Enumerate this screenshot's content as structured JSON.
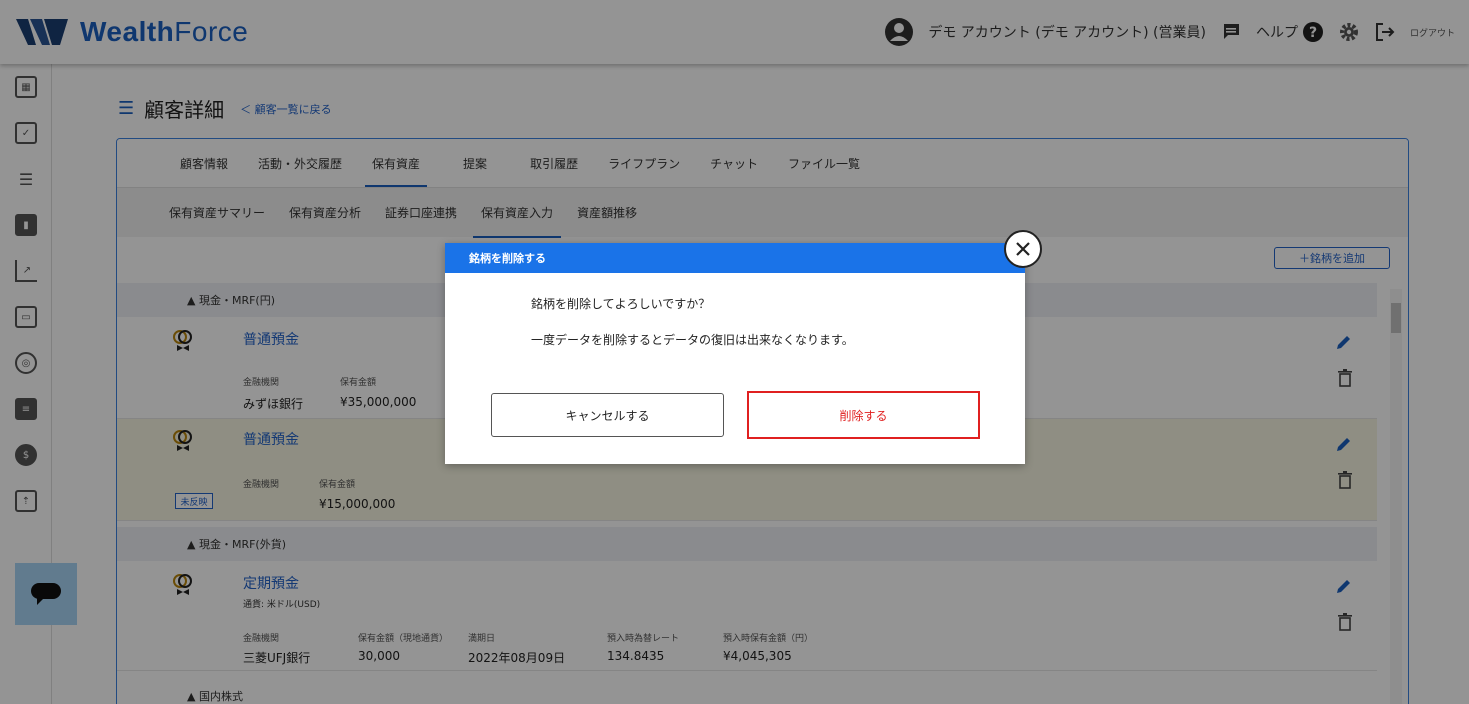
{
  "header": {
    "logo_text_bold": "Wealth",
    "logo_text_light": "Force",
    "user_name": "デモ アカウント (デモ アカウント) (営業員)",
    "help_label": "ヘルプ",
    "logout_label": "ログアウト"
  },
  "page": {
    "title": "顧客詳細",
    "back_link": "＜ 顧客一覧に戻る"
  },
  "tabs": [
    "顧客情報",
    "活動・外交履歴",
    "保有資産",
    "提案",
    "取引履歴",
    "ライフプラン",
    "チャット",
    "ファイル一覧"
  ],
  "subtabs": [
    "保有資産サマリー",
    "保有資産分析",
    "証券口座連携",
    "保有資産入力",
    "資産額推移"
  ],
  "add_button": "＋銘柄を追加",
  "sections": {
    "cash_jpy": "▲ 現金・MRF(円)",
    "cash_fx": "▲ 現金・MRF(外貨)",
    "domestic_stock": "▲ 国内株式"
  },
  "rows": {
    "r1": {
      "name": "普通預金",
      "lbl_inst": "金融機関",
      "lbl_amount": "保有金額",
      "inst": "みずほ銀行",
      "amount": "¥35,000,000"
    },
    "r2": {
      "name": "普通預金",
      "lbl_inst": "金融機関",
      "lbl_amount": "保有金額",
      "amount": "¥15,000,000",
      "badge": "未反映"
    },
    "r3": {
      "name": "定期預金",
      "currency": "通貨: 米ドル(USD)",
      "lbl_inst": "金融機関",
      "lbl_amount": "保有金額（現地通貨）",
      "lbl_maturity": "満期日",
      "lbl_rate": "預入時為替レート",
      "lbl_jpy": "預入時保有金額（円）",
      "inst": "三菱UFJ銀行",
      "amount": "30,000",
      "maturity": "2022年08月09日",
      "rate": "134.8435",
      "jpy": "¥4,045,305"
    }
  },
  "modal": {
    "title": "銘柄を削除する",
    "message1": "銘柄を削除してよろしいですか？",
    "message2": "一度データを削除するとデータの復旧は出来なくなります。",
    "cancel_label": "キャンセルする",
    "delete_label": "削除する"
  },
  "colors": {
    "brand": "#1a5fc0",
    "modal_header": "#1a73e8",
    "danger": "#e02020",
    "chat_fab": "#a8d4f5"
  }
}
